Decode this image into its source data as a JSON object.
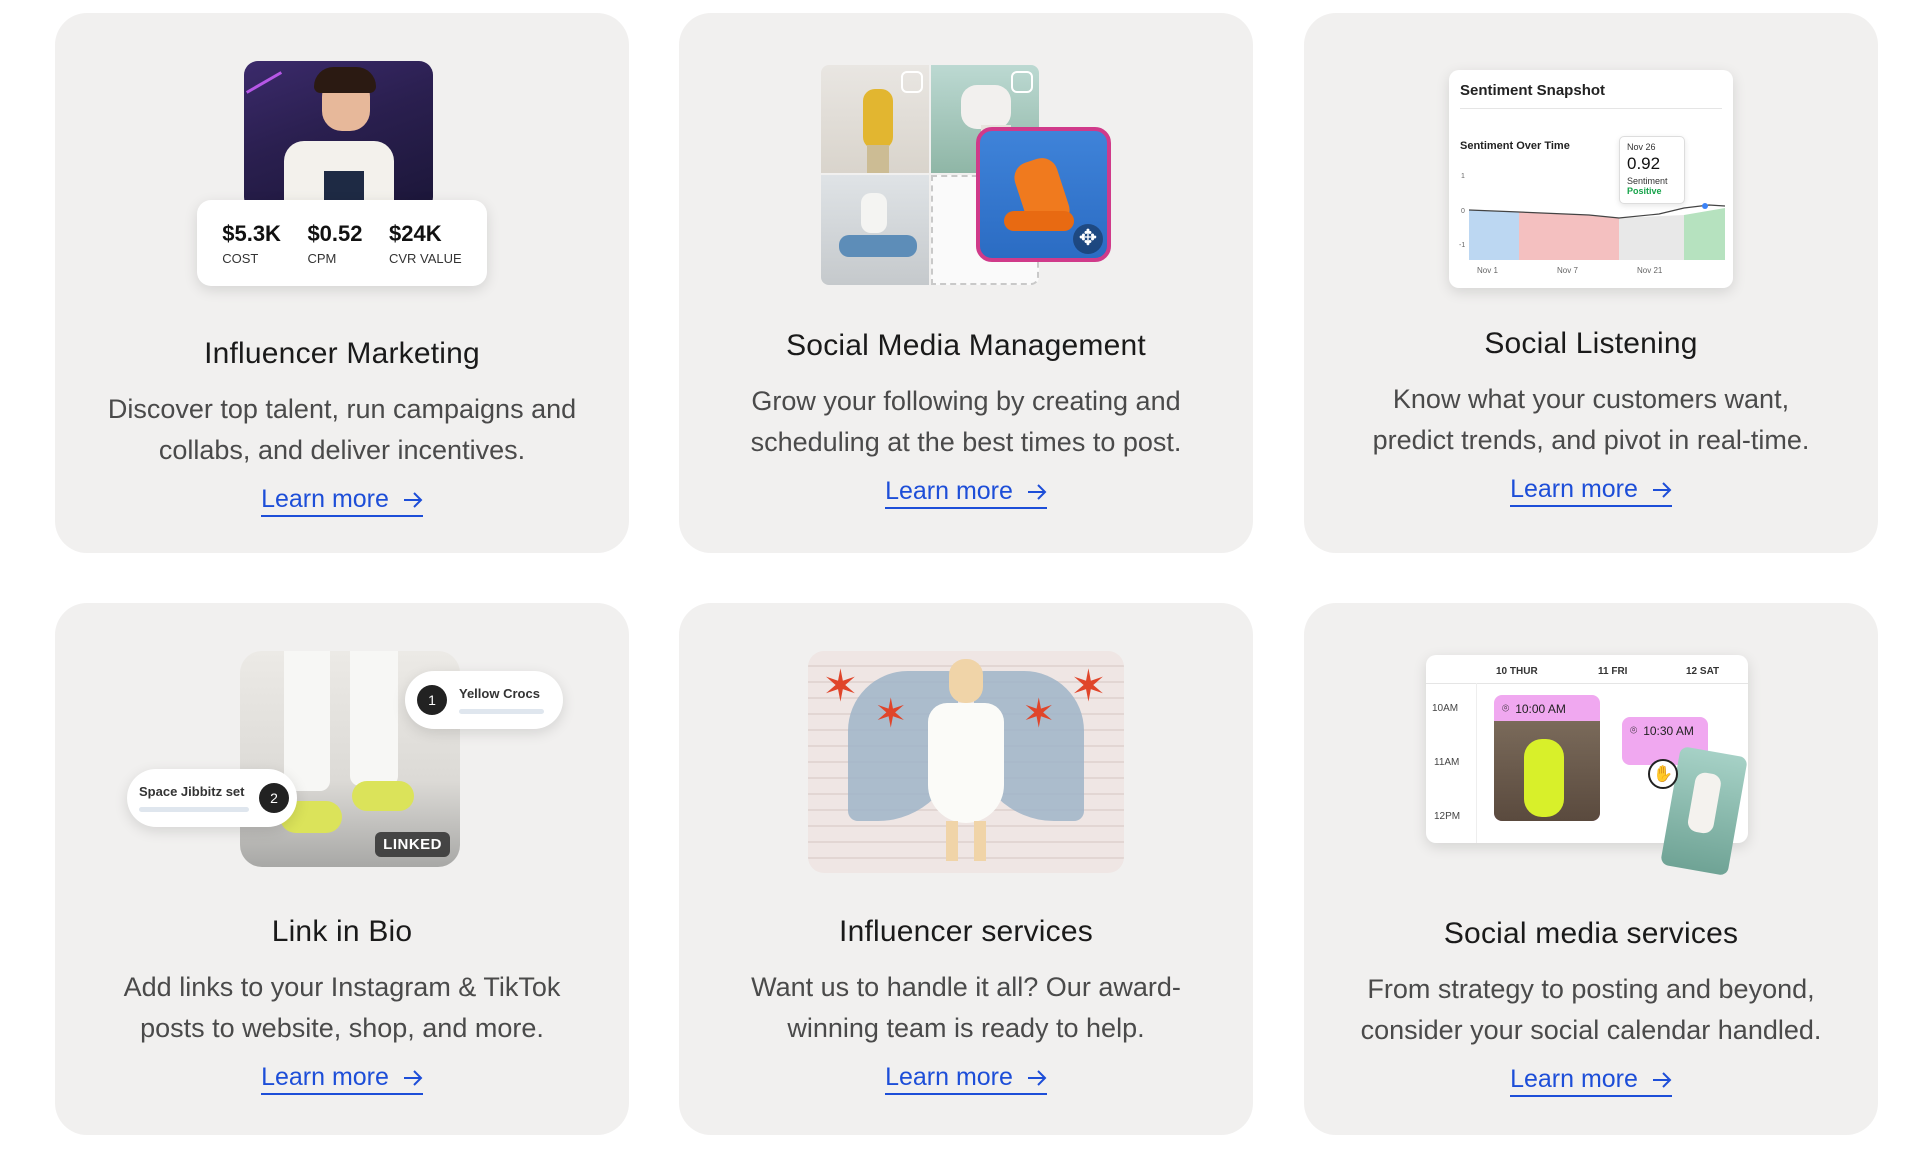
{
  "cards": [
    {
      "title": "Influencer Marketing",
      "desc_line1": "Discover top talent, run campaigns and",
      "desc_line2": "collabs, and deliver incentives.",
      "link": "Learn more",
      "stats": [
        {
          "value": "$5.3K",
          "label": "COST"
        },
        {
          "value": "$0.52",
          "label": "CPM"
        },
        {
          "value": "$24K",
          "label": "CVR VALUE"
        }
      ]
    },
    {
      "title": "Social Media Management",
      "desc_line1": "Grow your following by creating and",
      "desc_line2": "scheduling at the best times to post.",
      "link": "Learn more"
    },
    {
      "title": "Social Listening",
      "desc_line1": "Know what your customers want,",
      "desc_line2": "predict trends, and pivot in real-time.",
      "link": "Learn more",
      "snapshot": {
        "heading": "Sentiment Snapshot",
        "chart_title": "Sentiment Over Time",
        "tooltip_date": "Nov 26",
        "tooltip_value": "0.92",
        "tooltip_label": "Sentiment",
        "tooltip_status": "Positive",
        "y_ticks": [
          "1",
          "0",
          "-1"
        ],
        "x_ticks": [
          "Nov 1",
          "Nov 7",
          "Nov 21"
        ]
      }
    },
    {
      "title": "Link in Bio",
      "desc_line1": "Add links to your Instagram & TikTok",
      "desc_line2": "posts to website, shop, and more.",
      "link": "Learn more",
      "tags": [
        {
          "num": "1",
          "text": "Yellow Crocs"
        },
        {
          "num": "2",
          "text": "Space Jibbitz set"
        }
      ],
      "badge": "LINKED"
    },
    {
      "title": "Influencer services",
      "desc_line1": "Want us to handle it all? Our award-",
      "desc_line2": "winning team is ready to help.",
      "link": "Learn more"
    },
    {
      "title": "Social media services",
      "desc_line1": "From strategy to posting and beyond,",
      "desc_line2": "consider your social calendar handled.",
      "link": "Learn more",
      "calendar": {
        "days": [
          "10 THUR",
          "11 FRI",
          "12 SAT"
        ],
        "times": [
          "10AM",
          "11AM",
          "12PM"
        ],
        "event1": "10:00 AM",
        "event2": "10:30 AM"
      }
    }
  ],
  "colors": {
    "card_bg": "#f1f0ef",
    "link": "#1d4ed8",
    "event_pink": "#f0a8f0",
    "positive": "#16a34a"
  }
}
